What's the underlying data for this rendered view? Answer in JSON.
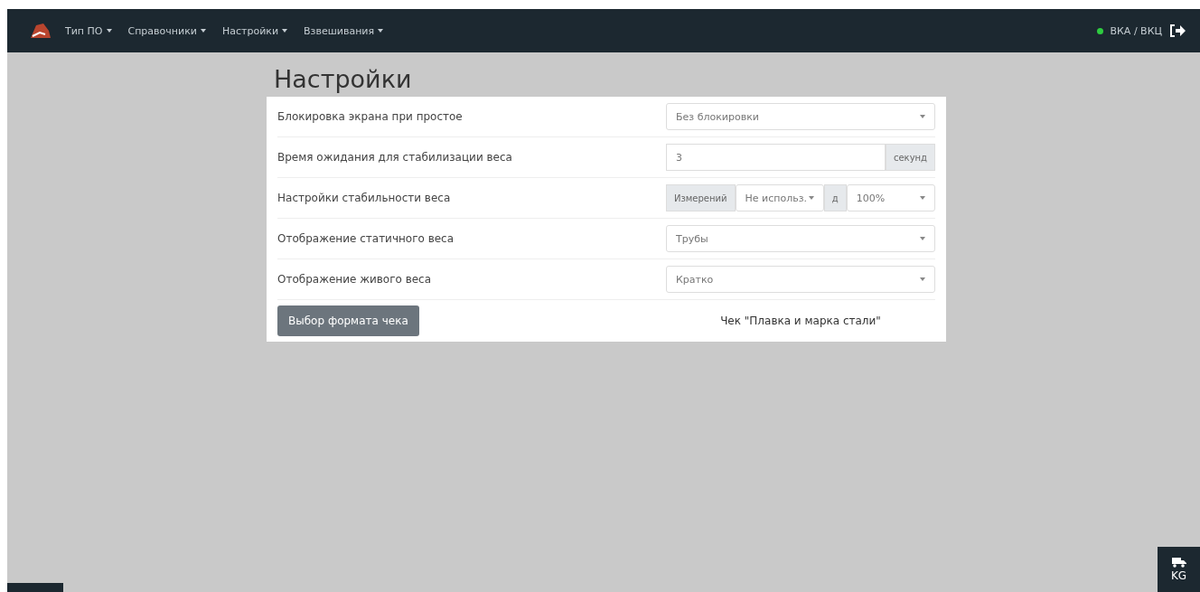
{
  "navbar": {
    "menus": [
      {
        "label": "Тип ПО"
      },
      {
        "label": "Справочники"
      },
      {
        "label": "Настройки"
      },
      {
        "label": "Взвешивания"
      }
    ],
    "status": {
      "online": true,
      "label": "ВКА / ВКЦ"
    }
  },
  "page": {
    "title": "Настройки"
  },
  "settings": [
    {
      "kind": "select",
      "label": "Блокировка экрана при простое",
      "value": "Без блокировки"
    },
    {
      "kind": "input",
      "label": "Время ожидания для стабилизации веса",
      "value": "3",
      "suffix": "секунд"
    },
    {
      "kind": "stability",
      "label": "Настройки стабильности веса",
      "prefix": "Измерений",
      "value": "Не использ.",
      "middle": "д",
      "value_2": "100%"
    },
    {
      "kind": "select",
      "label": "Отображение статичного веса",
      "value": "Трубы"
    },
    {
      "kind": "select",
      "label": "Отображение живого веса",
      "value": "Кратко"
    }
  ],
  "footer": {
    "button": "Выбор формата чека",
    "receipt": "Чек \"Плавка и марка стали\""
  },
  "corner_button": {
    "label": "KG"
  }
}
